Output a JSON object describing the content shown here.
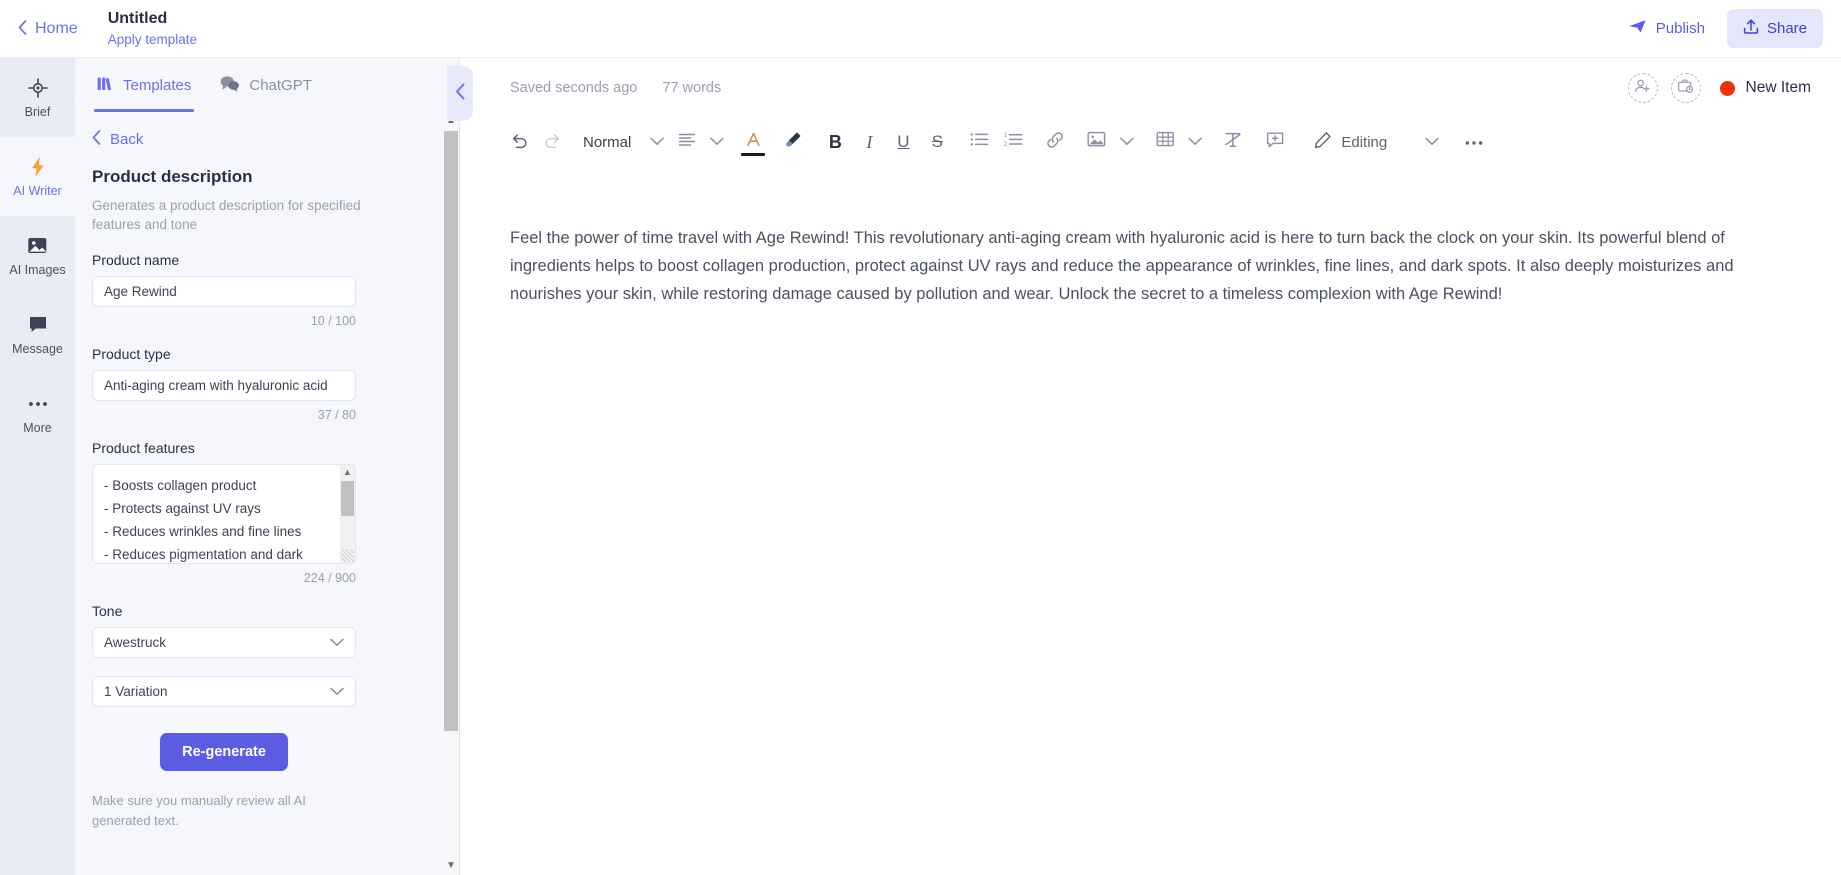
{
  "topbar": {
    "home_label": "Home",
    "home_icon": "chevron-left-icon",
    "doc_title": "Untitled",
    "apply_template_label": "Apply template",
    "publish_label": "Publish",
    "publish_icon": "send-icon",
    "share_label": "Share",
    "share_icon": "upload-icon"
  },
  "rail": {
    "items": [
      {
        "label": "Brief",
        "icon": "target-icon",
        "active": false
      },
      {
        "label": "AI Writer",
        "icon": "lightning-icon",
        "active": true
      },
      {
        "label": "AI Images",
        "icon": "image-icon",
        "active": false
      },
      {
        "label": "Message",
        "icon": "chat-bubble-icon",
        "active": false
      },
      {
        "label": "More",
        "icon": "ellipsis-icon",
        "active": false
      }
    ]
  },
  "panel": {
    "tabs": [
      {
        "label": "Templates",
        "icon": "templates-icon",
        "active": true
      },
      {
        "label": "ChatGPT",
        "icon": "chat-icon",
        "active": false
      }
    ],
    "back_label": "Back",
    "back_icon": "chevron-left-icon",
    "template_title": "Product description",
    "template_desc": "Generates a product description for specified features and tone",
    "fields": {
      "product_name": {
        "label": "Product name",
        "value": "Age Rewind",
        "placeholder": "Product name",
        "counter": "10 / 100"
      },
      "product_type": {
        "label": "Product type",
        "value": "Anti-aging cream with hyaluronic acid",
        "placeholder": "Product type",
        "counter": "37 / 80"
      },
      "product_features": {
        "label": "Product features",
        "value": "- Boosts collagen product\n- Protects against UV rays\n- Reduces wrinkles and fine lines\n- Reduces pigmentation and dark",
        "placeholder": "Product features",
        "counter": "224 / 900"
      },
      "tone": {
        "label": "Tone",
        "value": "Awestruck",
        "chevron": "chevron-down-icon"
      },
      "variations": {
        "value": "1 Variation",
        "chevron": "chevron-down-icon"
      }
    },
    "regenerate_label": "Re-generate",
    "disclaimer": "Make sure you manually review all AI generated text.",
    "collapse_icon": "chevron-left-icon"
  },
  "editor": {
    "saved_status": "Saved seconds ago",
    "word_count": "77 words",
    "add_user_icon": "add-person-icon",
    "add_asset_icon": "briefcase-clock-icon",
    "status_label": "New Item",
    "status_color": "#f03000",
    "toolbar": {
      "undo_icon": "undo-icon",
      "redo_icon": "redo-icon",
      "style_label": "Normal",
      "style_chevron": "chevron-down-icon",
      "align_icon": "align-left-icon",
      "align_chevron": "chevron-down-icon",
      "text_color_icon": "text-color-icon",
      "highlight_icon": "highlighter-icon",
      "bold_label": "B",
      "italic_label": "I",
      "underline_label": "U",
      "strikethrough_label": "S",
      "bullet_list_icon": "bullet-list-icon",
      "numbered_list_icon": "numbered-list-icon",
      "link_icon": "link-icon",
      "image_icon": "image-icon",
      "image_chevron": "chevron-down-icon",
      "table_icon": "table-icon",
      "table_chevron": "chevron-down-icon",
      "clear_format_icon": "clear-formatting-icon",
      "comment_icon": "add-comment-icon",
      "mode_icon": "pencil-icon",
      "mode_label": "Editing",
      "mode_chevron": "chevron-down-icon",
      "more_icon": "ellipsis-icon"
    },
    "document_text": "Feel the power of time travel with Age Rewind! This revolutionary anti-aging cream with hyaluronic acid is here to turn back the clock on your skin. Its powerful blend of ingredients helps to boost collagen production, protect against UV rays and reduce the appearance of wrinkles, fine lines, and dark spots. It also deeply moisturizes and nourishes your skin, while restoring damage caused by pollution and wear. Unlock the secret to a timeless complexion with Age Rewind!"
  },
  "colors": {
    "accent": "#6b72e8",
    "accent_strong": "#5b5ce2",
    "panel_bg": "#f5f7fc",
    "rail_bg": "#e9ecf5",
    "status_red": "#f03000"
  }
}
